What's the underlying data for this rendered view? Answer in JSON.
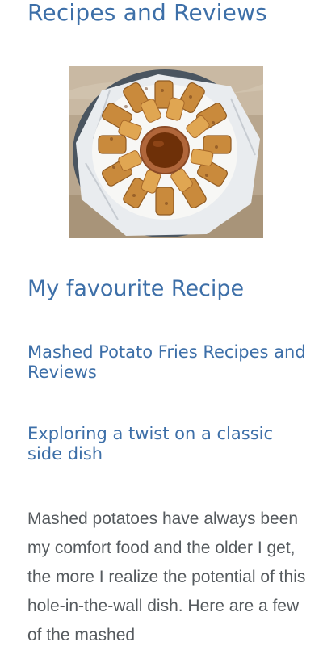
{
  "header": {
    "site_title": "Recipes and Reviews"
  },
  "hero_image": {
    "alt": "Mashed potato fries on a plate with dipping sauce"
  },
  "sections": {
    "favourite_heading": "My favourite Recipe",
    "recipe_title": "Mashed Potato Fries Recipes and Reviews",
    "recipe_subtitle": "Exploring a twist on a classic side dish",
    "intro_text": "Mashed potatoes have always been my comfort food and the older I get, the more I realize the potential of this hole-in-the-wall dish. Here are a few of the mashed"
  },
  "colors": {
    "accent": "#3d6fa8",
    "body_text": "#555a5e"
  }
}
